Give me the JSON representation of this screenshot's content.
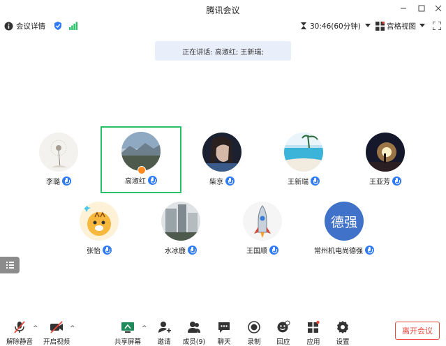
{
  "window": {
    "title": "腾讯会议"
  },
  "toolbar": {
    "meeting_info_label": "会议详情",
    "timer": "30:46(60分钟)",
    "view_label": "宫格视图"
  },
  "speaking": {
    "text": "正在讲话: 高淑红; 王新瑞;"
  },
  "participants": [
    {
      "name": "李璐"
    },
    {
      "name": "高淑红"
    },
    {
      "name": "柴京"
    },
    {
      "name": "王新瑞"
    },
    {
      "name": "王亚芳"
    },
    {
      "name": "张怡"
    },
    {
      "name": "水冰鹿"
    },
    {
      "name": "王国顺"
    },
    {
      "name": "常州机电尚德强",
      "avatar_text": "德强"
    }
  ],
  "bottom": {
    "unmute": "解除静音",
    "video": "开启视频",
    "share": "共享屏幕",
    "invite": "邀请",
    "members": "成员(9)",
    "chat": "聊天",
    "record": "录制",
    "react": "回应",
    "apps": "应用",
    "settings": "设置",
    "leave": "离开会议"
  },
  "colors": {
    "accent": "#2f7cf6",
    "active_border": "#27c267",
    "leave": "#e8473c",
    "host_badge": "#ff8a1e"
  }
}
